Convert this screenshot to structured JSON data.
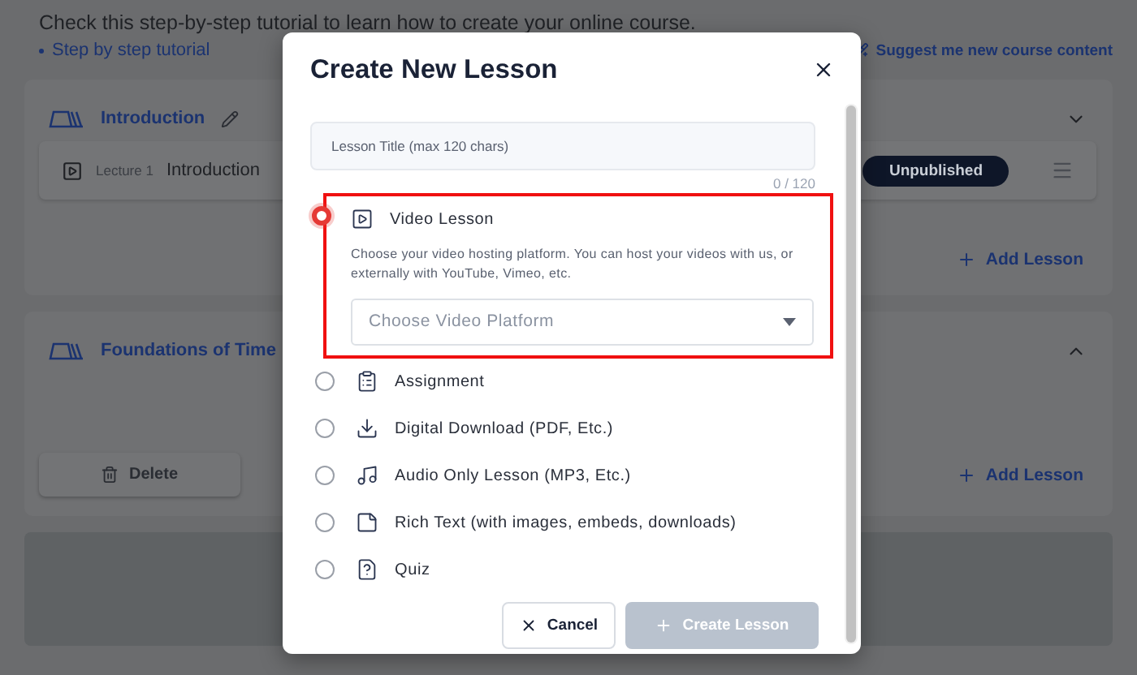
{
  "page": {
    "intro": "Check this step-by-step tutorial to learn how to create your online course.",
    "tutorial_link": "Step by step tutorial",
    "suggest_link": "Suggest me new course content"
  },
  "sections": [
    {
      "title": "Introduction",
      "expanded": false,
      "lectures": [
        {
          "label": "Lecture 1",
          "title": "Introduction",
          "status": "Unpublished"
        }
      ],
      "add_label": "Add Lesson"
    },
    {
      "title": "Foundations of Time",
      "expanded": true,
      "delete_label": "Delete",
      "add_label": "Add Lesson"
    }
  ],
  "dialog": {
    "title": "Create New Lesson",
    "title_field": {
      "placeholder": "Lesson Title (max 120 chars)",
      "counter": "0 / 120"
    },
    "options": [
      {
        "kind": "video",
        "label": "Video Lesson",
        "selected": true,
        "highlighted": true,
        "description": "Choose your video hosting platform. You can host your videos with us, or externally with YouTube, Vimeo, etc.",
        "platform_placeholder": "Choose Video Platform"
      },
      {
        "kind": "assignment",
        "label": "Assignment",
        "selected": false,
        "highlighted": false
      },
      {
        "kind": "download",
        "label": "Digital Download (PDF, Etc.)",
        "selected": false,
        "highlighted": false
      },
      {
        "kind": "audio",
        "label": "Audio Only Lesson (MP3, Etc.)",
        "selected": false,
        "highlighted": false
      },
      {
        "kind": "richtext",
        "label": "Rich Text (with images, embeds, downloads)",
        "selected": false,
        "highlighted": false
      },
      {
        "kind": "quiz",
        "label": "Quiz",
        "selected": false,
        "highlighted": false
      }
    ],
    "cancel": "Cancel",
    "create": "Create Lesson",
    "create_disabled": true
  }
}
